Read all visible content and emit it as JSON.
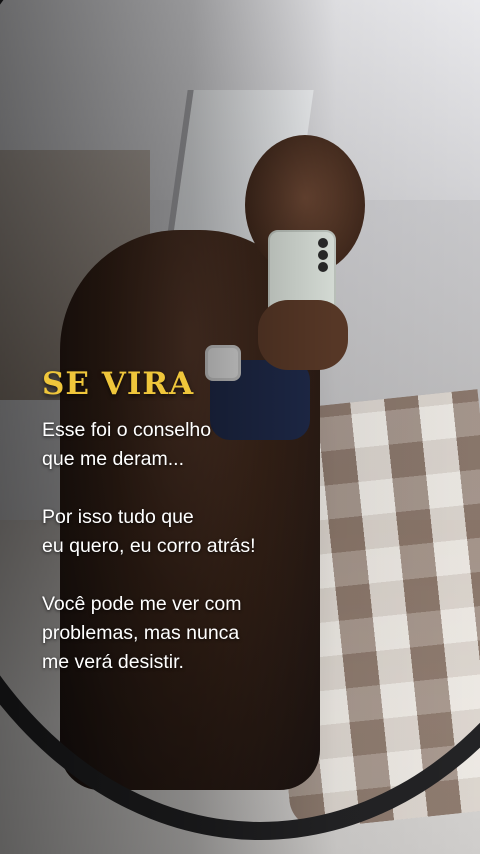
{
  "overlay": {
    "title": "SE VIRA",
    "title_color": "#efc63b",
    "paragraphs": [
      [
        "Esse foi o conselho",
        "que me deram..."
      ],
      [
        "Por isso tudo que",
        "eu quero, eu corro atrás!"
      ],
      [
        "Você pode me ver com",
        "problemas, mas nunca",
        "me verá desistir."
      ]
    ]
  }
}
